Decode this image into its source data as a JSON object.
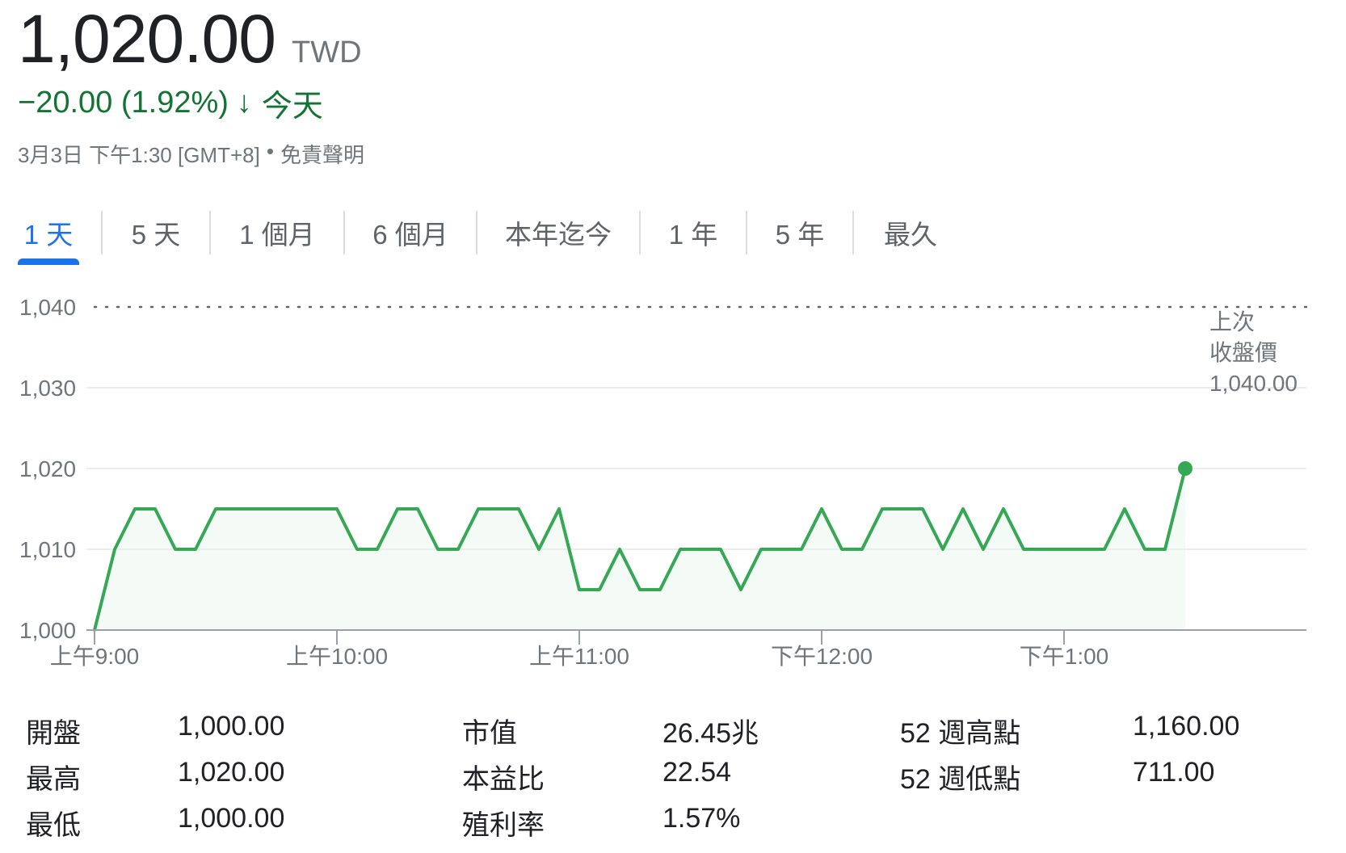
{
  "header": {
    "price": "1,020.00",
    "currency": "TWD",
    "change": "−20.00 (1.92%)",
    "change_arrow": "↓",
    "change_period": "今天",
    "timestamp": "3月3日 下午1:30 [GMT+8]",
    "separator": "•",
    "disclaimer": "免責聲明",
    "down_color": "#137333"
  },
  "tabs": [
    {
      "label": "1 天",
      "active": true
    },
    {
      "label": "5 天",
      "active": false
    },
    {
      "label": "1 個月",
      "active": false
    },
    {
      "label": "6 個月",
      "active": false
    },
    {
      "label": "本年迄今",
      "active": false
    },
    {
      "label": "1 年",
      "active": false
    },
    {
      "label": "5 年",
      "active": false
    },
    {
      "label": "最久",
      "active": false
    }
  ],
  "chart_data": {
    "type": "line",
    "ylim": [
      1000,
      1040
    ],
    "y_ticks": [
      "1,000",
      "1,010",
      "1,020",
      "1,030",
      "1,040"
    ],
    "y_tick_values": [
      1000,
      1010,
      1020,
      1030,
      1040
    ],
    "x_ticks": [
      "上午9:00",
      "上午10:00",
      "上午11:00",
      "下午12:00",
      "下午1:00"
    ],
    "x_tick_values": [
      "09:00",
      "10:00",
      "11:00",
      "12:00",
      "13:00"
    ],
    "xlim": [
      "09:00",
      "14:00"
    ],
    "grid": true,
    "line_color": "#34a853",
    "previous_close": {
      "value": 1040,
      "label_lines": [
        "上次",
        "收盤價"
      ],
      "value_label": "1,040.00"
    },
    "series": [
      {
        "x": [
          "09:00",
          "09:05",
          "09:10",
          "09:15",
          "09:20",
          "09:25",
          "09:30",
          "09:35",
          "09:40",
          "09:45",
          "09:50",
          "09:55",
          "10:00",
          "10:05",
          "10:10",
          "10:15",
          "10:20",
          "10:25",
          "10:30",
          "10:35",
          "10:40",
          "10:45",
          "10:50",
          "10:55",
          "11:00",
          "11:05",
          "11:10",
          "11:15",
          "11:20",
          "11:25",
          "11:30",
          "11:35",
          "11:40",
          "11:45",
          "11:50",
          "11:55",
          "12:00",
          "12:05",
          "12:10",
          "12:15",
          "12:20",
          "12:25",
          "12:30",
          "12:35",
          "12:40",
          "12:45",
          "12:50",
          "12:55",
          "13:00",
          "13:05",
          "13:10",
          "13:15",
          "13:20",
          "13:25",
          "13:30"
        ],
        "values": [
          1000,
          1010,
          1015,
          1015,
          1010,
          1010,
          1015,
          1015,
          1015,
          1015,
          1015,
          1015,
          1015,
          1010,
          1010,
          1015,
          1015,
          1010,
          1010,
          1015,
          1015,
          1015,
          1010,
          1015,
          1005,
          1005,
          1010,
          1005,
          1005,
          1010,
          1010,
          1010,
          1005,
          1010,
          1010,
          1010,
          1015,
          1010,
          1010,
          1015,
          1015,
          1015,
          1010,
          1015,
          1010,
          1015,
          1010,
          1010,
          1010,
          1010,
          1010,
          1015,
          1010,
          1010,
          1020
        ]
      }
    ]
  },
  "stats": {
    "col1": [
      {
        "label": "開盤",
        "value": "1,000.00"
      },
      {
        "label": "最高",
        "value": "1,020.00"
      },
      {
        "label": "最低",
        "value": "1,000.00"
      }
    ],
    "col2": [
      {
        "label": "市值",
        "value": "26.45兆"
      },
      {
        "label": "本益比",
        "value": "22.54"
      },
      {
        "label": "殖利率",
        "value": "1.57%"
      }
    ],
    "col3": [
      {
        "label": "52 週高點",
        "value": "1,160.00"
      },
      {
        "label": "52 週低點",
        "value": "711.00"
      }
    ]
  }
}
